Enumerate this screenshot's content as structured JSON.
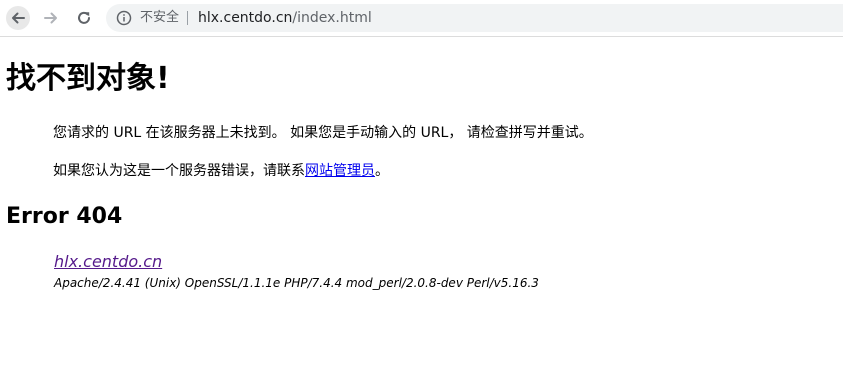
{
  "browser": {
    "security_label": "不安全",
    "url_host": "hlx.centdo.cn",
    "url_path": "/index.html"
  },
  "page": {
    "title": "找不到对象!",
    "message_1": "您请求的 URL 在该服务器上未找到。 如果您是手动输入的 URL， 请检查拼写并重试。",
    "message_2_prefix": "如果您认为这是一个服务器错误，请联系",
    "message_2_link": "网站管理员",
    "message_2_suffix": "。",
    "error_heading": "Error 404",
    "server_link": "hlx.centdo.cn",
    "server_signature": "Apache/2.4.41 (Unix) OpenSSL/1.1.1e PHP/7.4.4 mod_perl/2.0.8-dev Perl/v5.16.3"
  },
  "icons": [
    "back-icon",
    "forward-icon",
    "reload-icon",
    "info-icon"
  ],
  "colors": {
    "link": "#0000ee",
    "visited_link": "#551a8b",
    "omnibox_bg": "#f1f3f4"
  }
}
